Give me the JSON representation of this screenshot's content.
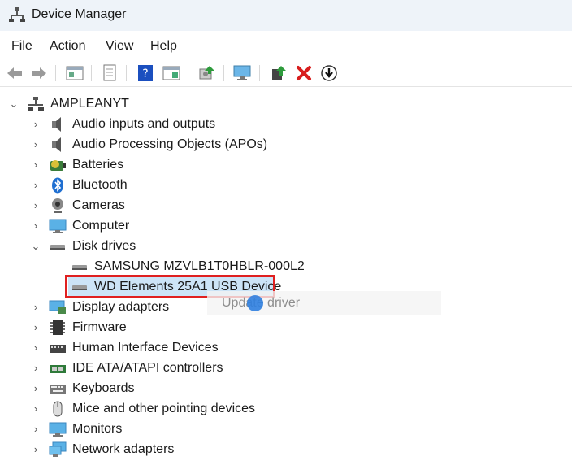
{
  "window": {
    "title": "Device Manager"
  },
  "menu": [
    "File",
    "Action",
    "View",
    "Help"
  ],
  "toolbar": {
    "icons": [
      "back-arrow-icon",
      "forward-arrow-icon",
      "properties-grid-icon",
      "document-icon",
      "help-icon",
      "view-pane-icon",
      "scan-hardware-icon",
      "monitor-icon",
      "enable-device-icon",
      "uninstall-device-icon",
      "update-driver-icon"
    ],
    "colors": {
      "red_x": "#d81e1e",
      "green_arrow": "#2e9b3c",
      "help_blue": "#1b4fbf"
    }
  },
  "tree": {
    "root": "AMPLEANYT",
    "items": [
      {
        "label": "Audio inputs and outputs",
        "icon": "speaker-icon"
      },
      {
        "label": "Audio Processing Objects (APOs)",
        "icon": "speaker-icon"
      },
      {
        "label": "Batteries",
        "icon": "battery-icon"
      },
      {
        "label": "Bluetooth",
        "icon": "bluetooth-icon"
      },
      {
        "label": "Cameras",
        "icon": "camera-icon"
      },
      {
        "label": "Computer",
        "icon": "computer-icon"
      },
      {
        "label": "Disk drives",
        "icon": "disk-drive-icon",
        "expanded": true,
        "children": [
          {
            "label": "SAMSUNG MZVLB1T0HBLR-000L2",
            "icon": "disk-drive-icon"
          },
          {
            "label": "WD Elements 25A1 USB Device",
            "icon": "disk-drive-icon",
            "selected": true,
            "highlight_color": "#e02020"
          }
        ]
      },
      {
        "label": "Display adapters",
        "icon": "display-adapter-icon"
      },
      {
        "label": "Firmware",
        "icon": "firmware-chip-icon"
      },
      {
        "label": "Human Interface Devices",
        "icon": "hid-icon"
      },
      {
        "label": "IDE ATA/ATAPI controllers",
        "icon": "ide-controller-icon"
      },
      {
        "label": "Keyboards",
        "icon": "keyboard-icon"
      },
      {
        "label": "Mice and other pointing devices",
        "icon": "mouse-icon"
      },
      {
        "label": "Monitors",
        "icon": "monitor-icon"
      },
      {
        "label": "Network adapters",
        "icon": "network-adapter-icon"
      }
    ]
  },
  "context_menu_ghost": {
    "label": "Update driver"
  }
}
